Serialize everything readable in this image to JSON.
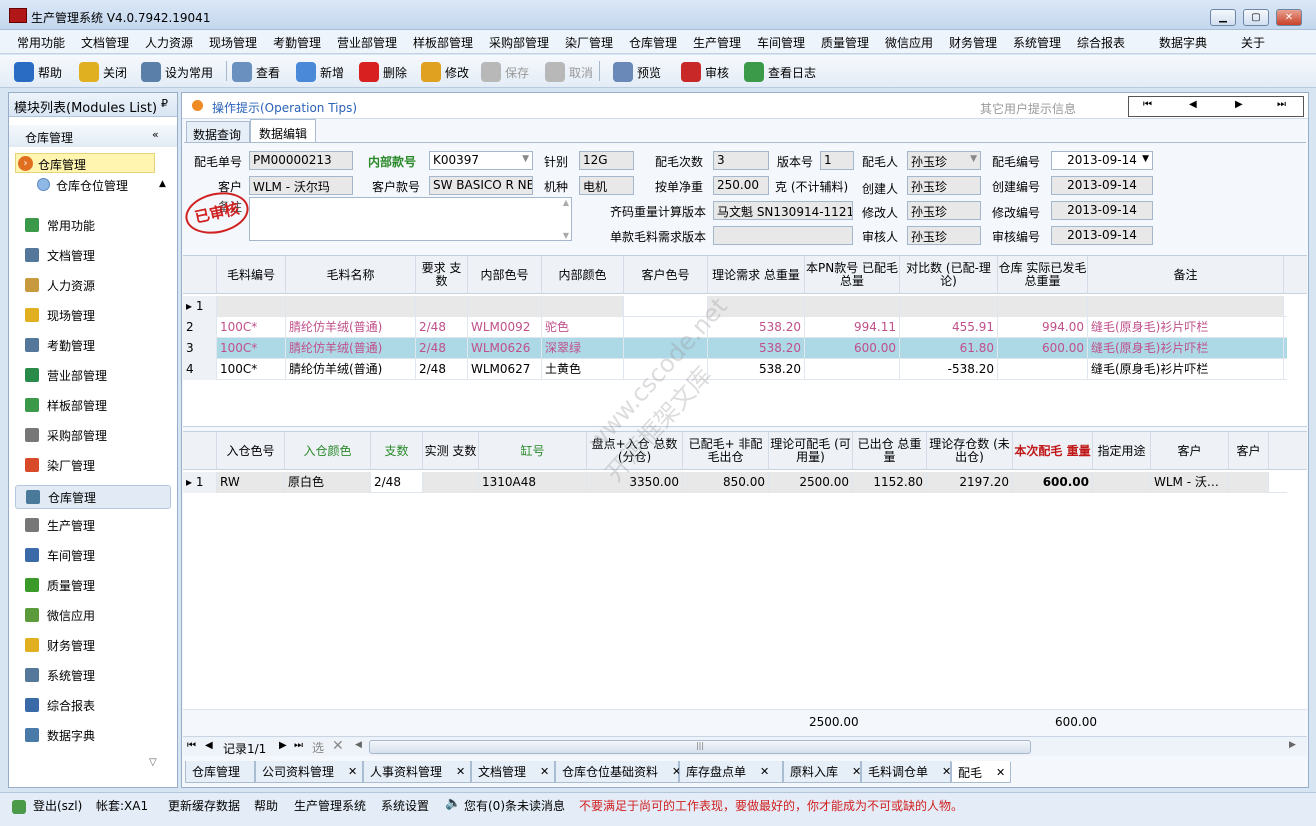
{
  "window": {
    "title": "生产管理系统 V4.0.7942.19041",
    "icon": "erp-logo-icon",
    "controls": [
      "minimize",
      "maximize",
      "close"
    ]
  },
  "menu": [
    "常用功能",
    "文档管理",
    "人力资源",
    "现场管理",
    "考勤管理",
    "营业部管理",
    "样板部管理",
    "采购部管理",
    "染厂管理",
    "仓库管理",
    "生产管理",
    "车间管理",
    "质量管理",
    "微信应用",
    "财务管理",
    "系统管理",
    "综合报表",
    "数据字典",
    "关于"
  ],
  "toolbar": [
    {
      "label": "帮助",
      "icon": "help-icon",
      "color": "#2a6bc4"
    },
    {
      "label": "关闭",
      "icon": "exit-icon",
      "color": "#e0b020"
    },
    {
      "label": "设为常用",
      "icon": "printer-icon",
      "color": "#5a7fa8"
    },
    {
      "label": "查看",
      "icon": "view-icon",
      "color": "#6a90c0"
    },
    {
      "label": "新增",
      "icon": "add-doc-icon",
      "color": "#4a88d8"
    },
    {
      "label": "删除",
      "icon": "delete-icon",
      "color": "#d82020"
    },
    {
      "label": "修改",
      "icon": "edit-icon",
      "color": "#e0a020"
    },
    {
      "label": "保存",
      "icon": "save-icon",
      "color": "#b8b8b8"
    },
    {
      "label": "取消",
      "icon": "cancel-icon",
      "color": "#b8b8b8"
    },
    {
      "label": "预览",
      "icon": "preview-icon",
      "color": "#6a88b8"
    },
    {
      "label": "审核",
      "icon": "stamp-icon",
      "color": "#c82828"
    },
    {
      "label": "查看日志",
      "icon": "log-icon",
      "color": "#3a9a4a"
    }
  ],
  "sidebar": {
    "title": "模块列表(Modules List)",
    "group": "仓库管理",
    "tree": [
      "仓库管理",
      "仓库仓位管理"
    ],
    "modules": [
      {
        "label": "常用功能",
        "icon": "common-icon",
        "color": "#3a9a4a"
      },
      {
        "label": "文档管理",
        "icon": "document-icon",
        "color": "#557799"
      },
      {
        "label": "人力资源",
        "icon": "people-icon",
        "color": "#c89a40"
      },
      {
        "label": "现场管理",
        "icon": "crown-icon",
        "color": "#e0b020"
      },
      {
        "label": "考勤管理",
        "icon": "clock-icon",
        "color": "#557799"
      },
      {
        "label": "营业部管理",
        "icon": "globe-icon",
        "color": "#2a8a4a"
      },
      {
        "label": "样板部管理",
        "icon": "puzzle-icon",
        "color": "#3a9a4a"
      },
      {
        "label": "采购部管理",
        "icon": "cart-icon",
        "color": "#777777"
      },
      {
        "label": "染厂管理",
        "icon": "pie-icon",
        "color": "#d84a2a"
      },
      {
        "label": "仓库管理",
        "icon": "warehouse-icon",
        "color": "#4a7a9a"
      },
      {
        "label": "生产管理",
        "icon": "wrench-icon",
        "color": "#777777"
      },
      {
        "label": "车间管理",
        "icon": "org-chart-icon",
        "color": "#3a6aa8"
      },
      {
        "label": "质量管理",
        "icon": "flag-icon",
        "color": "#3a9a2a"
      },
      {
        "label": "微信应用",
        "icon": "wechat-icon",
        "color": "#5a9a3a"
      },
      {
        "label": "财务管理",
        "icon": "shield-icon",
        "color": "#e0b020"
      },
      {
        "label": "系统管理",
        "icon": "tools-icon",
        "color": "#557799"
      },
      {
        "label": "综合报表",
        "icon": "bar-chart-icon",
        "color": "#3a6aa8"
      },
      {
        "label": "数据字典",
        "icon": "dictionary-icon",
        "color": "#4a7aa8"
      }
    ]
  },
  "tips": {
    "title": "操作提示(Operation Tips)",
    "other": "其它用户提示信息",
    "nav": [
      "⏮",
      "◀",
      "▶",
      "⏭"
    ]
  },
  "tabs": [
    "数据查询",
    "数据编辑"
  ],
  "form": {
    "stamp": "已审核",
    "peimao_no_label": "配毛单号",
    "peimao_no": "PM00000213",
    "style_label": "内部款号",
    "style": "K00397",
    "gauge_label": "针别",
    "gauge": "12G",
    "times_label": "配毛次数",
    "times": "3",
    "version_label": "版本号",
    "version": "1",
    "person_label": "配毛人",
    "person": "孙玉珍",
    "code_label": "配毛编号",
    "code": "2013-09-14",
    "customer_label": "客户",
    "customer": "WLM - 沃尔玛",
    "cust_style_label": "客户款号",
    "cust_style": "SW BASICO R NECK",
    "machine_label": "机种",
    "machine": "电机",
    "net_label": "按单净重",
    "net": "250.00",
    "net_unit": "克 (不计辅料)",
    "creator_label": "创建人",
    "creator": "孙玉珍",
    "create_label": "创建编号",
    "create": "2013-09-14",
    "remark_label": "备注",
    "calc_label": "齐码重量计算版本",
    "calc": "马文魁 SN130914-1121",
    "modifier_label": "修改人",
    "modifier": "孙玉珍",
    "modify_label": "修改编号",
    "modify": "2013-09-14",
    "single_label": "单款毛料需求版本",
    "single": "",
    "reviewer_label": "审核人",
    "reviewer": "孙玉珍",
    "review_label": "审核编号",
    "review": "2013-09-14"
  },
  "grid1": {
    "headers": [
      "毛料编号",
      "毛料名称",
      "要求 支数",
      "内部色号",
      "内部颜色",
      "客户色号",
      "理论需求 总重量",
      "本PN款号 已配毛总量",
      "对比数 (已配-理论)",
      "仓库 实际已发毛 总重量",
      "备注"
    ],
    "rows": [
      {
        "no": "1",
        "c": [
          "",
          "",
          "",
          "",
          "",
          "",
          "",
          "",
          "",
          "",
          ""
        ]
      },
      {
        "no": "2",
        "c": [
          "100C*",
          "腈纶仿羊绒(普通)",
          "2/48",
          "WLM0092",
          "驼色",
          "",
          "538.20",
          "994.11",
          "455.91",
          "994.00",
          "缝毛(原身毛)衫片吓栏"
        ]
      },
      {
        "no": "3",
        "c": [
          "100C*",
          "腈纶仿羊绒(普通)",
          "2/48",
          "WLM0626",
          "深翠绿",
          "",
          "538.20",
          "600.00",
          "61.80",
          "600.00",
          "缝毛(原身毛)衫片吓栏"
        ]
      },
      {
        "no": "4",
        "c": [
          "100C*",
          "腈纶仿羊绒(普通)",
          "2/48",
          "WLM0627",
          "土黄色",
          "",
          "538.20",
          "",
          "-538.20",
          "",
          "缝毛(原身毛)衫片吓栏"
        ]
      }
    ]
  },
  "grid2": {
    "headers": [
      "入仓色号",
      "入仓颜色",
      "支数",
      "实测 支数",
      "缸号",
      "盘点+入仓 总数(分仓)",
      "已配毛+ 非配毛出仓",
      "理论可配毛 (可用量)",
      "已出仓 总重量",
      "理论存仓数 (未出仓)",
      "本次配毛 重量",
      "指定用途",
      "客户",
      "客户"
    ],
    "rows": [
      {
        "no": "1",
        "c": [
          "RW",
          "原白色",
          "2/48",
          "",
          "1310A48",
          "3350.00",
          "850.00",
          "2500.00",
          "1152.80",
          "2197.20",
          "600.00",
          "",
          "WLM - 沃…",
          ""
        ]
      }
    ],
    "totals": {
      "avail": "2500.00",
      "this": "600.00"
    },
    "nav": {
      "record": "记录1/1",
      "filter": "选"
    }
  },
  "bottom_tabs": [
    "仓库管理",
    "公司资料管理",
    "人事资料管理",
    "文档管理",
    "仓库仓位基础资料",
    "库存盘点单",
    "原料入库",
    "毛料调仓单",
    "配毛"
  ],
  "watermark": [
    "www.cscode.net",
    "开源框架文库"
  ],
  "status": {
    "login": "登出(szl)",
    "account": "帐套:XA1",
    "refresh": "更新缓存数据",
    "help": "帮助",
    "system": "生产管理系统",
    "settings": "系统设置",
    "messages": "您有(0)条未读消息",
    "motto": "不要满足于尚可的工作表现，要做最好的，你才能成为不可或缺的人物。"
  }
}
